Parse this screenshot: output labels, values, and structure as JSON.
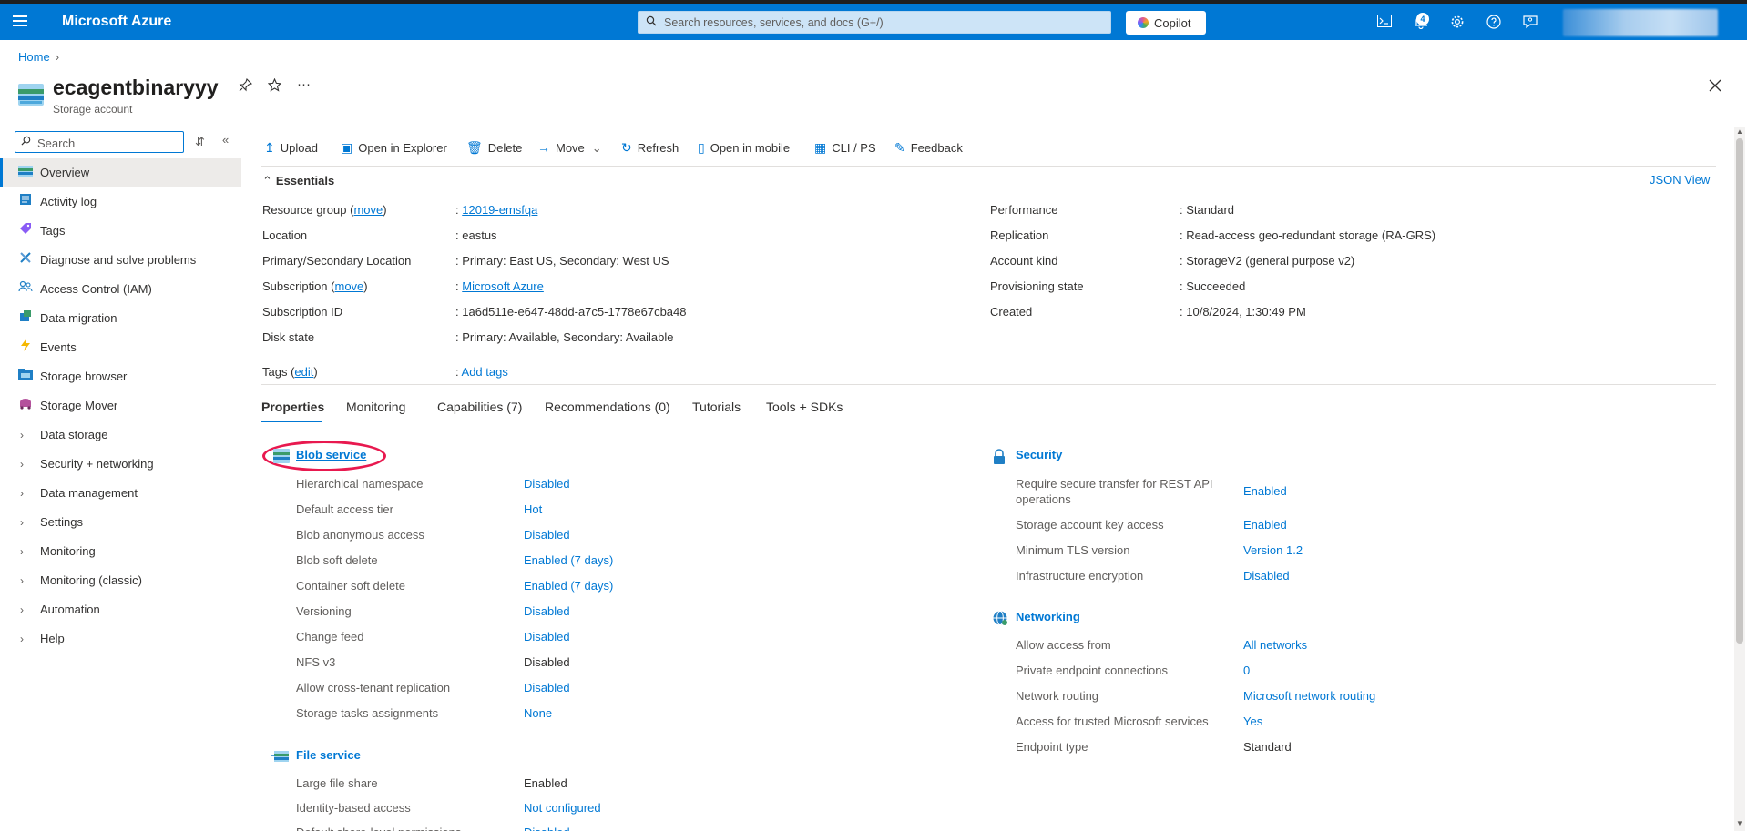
{
  "topbar": {
    "brand": "Microsoft Azure",
    "search_placeholder": "Search resources, services, and docs (G+/)",
    "copilot_label": "Copilot",
    "notification_count": "4"
  },
  "breadcrumb": {
    "home": "Home"
  },
  "resource": {
    "name": "ecagentbinaryyy",
    "type": "Storage account"
  },
  "sidebar": {
    "search_placeholder": "Search",
    "items": [
      {
        "label": "Overview",
        "icon": "overview-icon"
      },
      {
        "label": "Activity log",
        "icon": "activity-log-icon"
      },
      {
        "label": "Tags",
        "icon": "tag-icon"
      },
      {
        "label": "Diagnose and solve problems",
        "icon": "wrench-icon"
      },
      {
        "label": "Access Control (IAM)",
        "icon": "people-icon"
      },
      {
        "label": "Data migration",
        "icon": "migration-icon"
      },
      {
        "label": "Events",
        "icon": "lightning-icon"
      },
      {
        "label": "Storage browser",
        "icon": "folder-icon"
      },
      {
        "label": "Storage Mover",
        "icon": "mover-icon"
      },
      {
        "label": "Data storage",
        "icon": "chevron-right-icon"
      },
      {
        "label": "Security + networking",
        "icon": "chevron-right-icon"
      },
      {
        "label": "Data management",
        "icon": "chevron-right-icon"
      },
      {
        "label": "Settings",
        "icon": "chevron-right-icon"
      },
      {
        "label": "Monitoring",
        "icon": "chevron-right-icon"
      },
      {
        "label": "Monitoring (classic)",
        "icon": "chevron-right-icon"
      },
      {
        "label": "Automation",
        "icon": "chevron-right-icon"
      },
      {
        "label": "Help",
        "icon": "chevron-right-icon"
      }
    ]
  },
  "toolbar": {
    "upload": "Upload",
    "open_in_explorer": "Open in Explorer",
    "delete": "Delete",
    "move": "Move",
    "refresh": "Refresh",
    "open_in_mobile": "Open in mobile",
    "cli_ps": "CLI / PS",
    "feedback": "Feedback"
  },
  "essentials": {
    "title": "Essentials",
    "json_view": "JSON View",
    "left": {
      "resource_group_label": "Resource group (",
      "move_link": "move",
      "close_paren": ")",
      "resource_group_value": "12019-emsfqa",
      "location_label": "Location",
      "location_value": "eastus",
      "primary_secondary_label": "Primary/Secondary Location",
      "primary_secondary_value": "Primary: East US, Secondary: West US",
      "subscription_label": "Subscription (",
      "subscription_value": "Microsoft Azure",
      "subscription_id_label": "Subscription ID",
      "subscription_id_value": "1a6d511e-e647-48dd-a7c5-1778e67cba48",
      "disk_state_label": "Disk state",
      "disk_state_value": "Primary: Available, Secondary: Available",
      "tags_label": "Tags (",
      "edit_link": "edit",
      "tags_value": "Add tags"
    },
    "right": {
      "performance_label": "Performance",
      "performance_value": "Standard",
      "replication_label": "Replication",
      "replication_value": "Read-access geo-redundant storage (RA-GRS)",
      "account_kind_label": "Account kind",
      "account_kind_value": "StorageV2 (general purpose v2)",
      "provisioning_label": "Provisioning state",
      "provisioning_value": "Succeeded",
      "created_label": "Created",
      "created_value": "10/8/2024, 1:30:49 PM"
    },
    "colon": ":"
  },
  "tabs": [
    "Properties",
    "Monitoring",
    "Capabilities (7)",
    "Recommendations (0)",
    "Tutorials",
    "Tools + SDKs"
  ],
  "blob_service": {
    "title": "Blob service",
    "rows": [
      {
        "k": "Hierarchical namespace",
        "v": "Disabled",
        "link": true
      },
      {
        "k": "Default access tier",
        "v": "Hot",
        "link": true
      },
      {
        "k": "Blob anonymous access",
        "v": "Disabled",
        "link": true
      },
      {
        "k": "Blob soft delete",
        "v": "Enabled (7 days)",
        "link": true
      },
      {
        "k": "Container soft delete",
        "v": "Enabled (7 days)",
        "link": true
      },
      {
        "k": "Versioning",
        "v": "Disabled",
        "link": true
      },
      {
        "k": "Change feed",
        "v": "Disabled",
        "link": true
      },
      {
        "k": "NFS v3",
        "v": "Disabled",
        "link": false
      },
      {
        "k": "Allow cross-tenant replication",
        "v": "Disabled",
        "link": true
      },
      {
        "k": "Storage tasks assignments",
        "v": "None",
        "link": true
      }
    ]
  },
  "file_service": {
    "title": "File service",
    "rows": [
      {
        "k": "Large file share",
        "v": "Enabled",
        "link": false
      },
      {
        "k": "Identity-based access",
        "v": "Not configured",
        "link": true
      },
      {
        "k": "Default share-level permissions",
        "v": "Disabled",
        "link": true
      }
    ]
  },
  "security": {
    "title": "Security",
    "rows": [
      {
        "k": "Require secure transfer for REST API",
        "k2": "operations",
        "v": "Enabled",
        "link": true
      },
      {
        "k": "Storage account key access",
        "v": "Enabled",
        "link": true
      },
      {
        "k": "Minimum TLS version",
        "v": "Version 1.2",
        "link": true
      },
      {
        "k": "Infrastructure encryption",
        "v": "Disabled",
        "link": true
      }
    ]
  },
  "networking": {
    "title": "Networking",
    "rows": [
      {
        "k": "Allow access from",
        "v": "All networks",
        "link": true
      },
      {
        "k": "Private endpoint connections",
        "v": "0",
        "link": true
      },
      {
        "k": "Network routing",
        "v": "Microsoft network routing",
        "link": true
      },
      {
        "k": "Access for trusted Microsoft services",
        "v": "Yes",
        "link": true
      },
      {
        "k": "Endpoint type",
        "v": "Standard",
        "link": false
      }
    ]
  },
  "colors": {
    "accent": "#0078d4",
    "topbar": "#0078d4",
    "highlight_ring": "#e8194f"
  }
}
